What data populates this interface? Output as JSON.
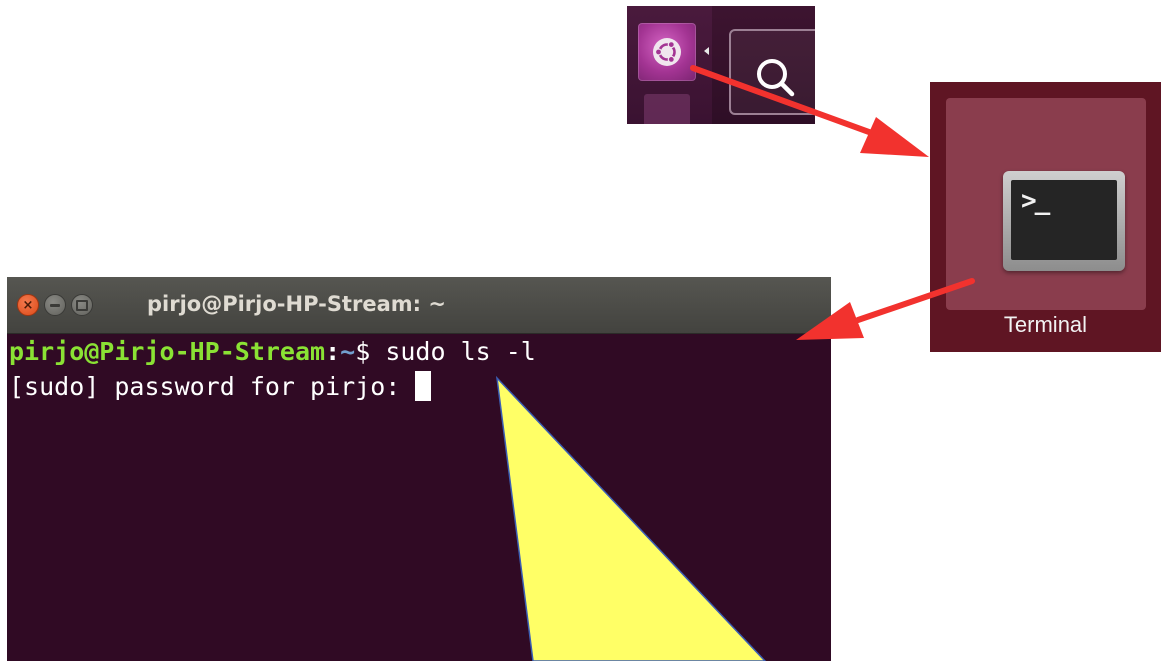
{
  "launcher": {
    "dash_icon": "ubuntu-logo-icon",
    "search_icon": "search-icon"
  },
  "terminal_tile": {
    "icon": "terminal-icon",
    "icon_prompt": ">_",
    "label": "Terminal"
  },
  "terminal_window": {
    "title": "pirjo@Pirjo-HP-Stream: ~",
    "buttons": [
      "close",
      "minimize",
      "maximize"
    ],
    "lines": [
      {
        "user_host": "pirjo@Pirjo-HP-Stream",
        "separator": ":",
        "directory": "~",
        "symbol": "$ ",
        "command": "sudo ls -l"
      },
      {
        "text": "[sudo] password for pirjo: "
      }
    ]
  },
  "annotations": {
    "arrow_color": "#f2322e",
    "highlight_color": "#ffff66"
  },
  "colors": {
    "terminal_bg": "#300a24",
    "prompt_user": "#8ae234",
    "prompt_dir": "#729fcf",
    "title_bar": "#4a4a46",
    "tile_bg": "#5f1523"
  }
}
